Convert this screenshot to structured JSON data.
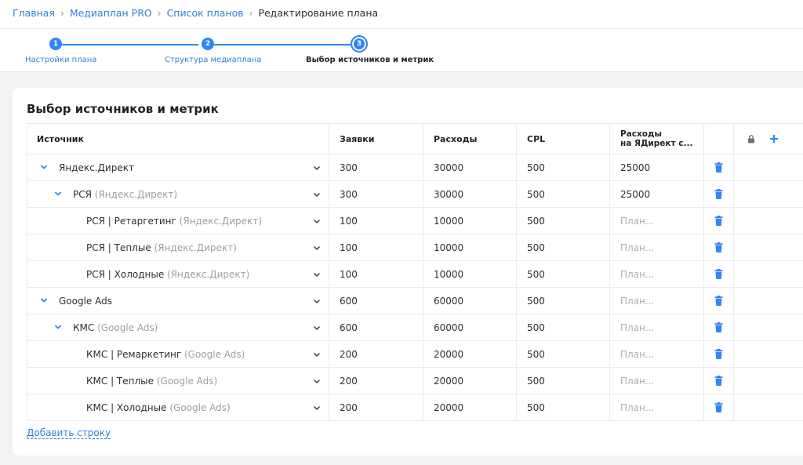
{
  "breadcrumb": {
    "items": [
      "Главная",
      "Медиаплан PRO",
      "Список планов"
    ],
    "current": "Редактирование плана"
  },
  "stepper": {
    "steps": [
      {
        "num": "1",
        "label": "Настройки плана",
        "state": "done"
      },
      {
        "num": "2",
        "label": "Структура медиаплана",
        "state": "done"
      },
      {
        "num": "3",
        "label": "Выбор источников и метрик",
        "state": "active"
      }
    ]
  },
  "card": {
    "title": "Выбор источников и метрик",
    "add_row": "Добавить строку"
  },
  "table": {
    "headers": {
      "source": "Источник",
      "leads": "Заявки",
      "cost": "Расходы",
      "cpl": "CPL",
      "yd_line1": "Расходы",
      "yd_line2": "на ЯДирект с..."
    },
    "placeholder": "План...",
    "rows": [
      {
        "name": "Яндекс.Директ",
        "sub": "",
        "leads": "300",
        "cost": "30000",
        "cpl": "500",
        "yd": "25000"
      },
      {
        "name": "РСЯ",
        "sub": "(Яндекс.Директ)",
        "leads": "300",
        "cost": "30000",
        "cpl": "500",
        "yd": "25000"
      },
      {
        "name": "РСЯ | Ретаргетинг",
        "sub": "(Яндекс.Директ)",
        "leads": "100",
        "cost": "10000",
        "cpl": "500",
        "yd": ""
      },
      {
        "name": "РСЯ | Теплые",
        "sub": "(Яндекс.Директ)",
        "leads": "100",
        "cost": "10000",
        "cpl": "500",
        "yd": ""
      },
      {
        "name": "РСЯ | Холодные",
        "sub": "(Яндекс.Директ)",
        "leads": "100",
        "cost": "10000",
        "cpl": "500",
        "yd": ""
      },
      {
        "name": "Google Ads",
        "sub": "",
        "leads": "600",
        "cost": "60000",
        "cpl": "500",
        "yd": ""
      },
      {
        "name": "КМС",
        "sub": "(Google Ads)",
        "leads": "600",
        "cost": "60000",
        "cpl": "500",
        "yd": ""
      },
      {
        "name": "КМС | Ремаркетинг",
        "sub": "(Google Ads)",
        "leads": "200",
        "cost": "20000",
        "cpl": "500",
        "yd": ""
      },
      {
        "name": "КМС | Теплые",
        "sub": "(Google Ads)",
        "leads": "200",
        "cost": "20000",
        "cpl": "500",
        "yd": ""
      },
      {
        "name": "КМС | Холодные",
        "sub": "(Google Ads)",
        "leads": "200",
        "cost": "20000",
        "cpl": "500",
        "yd": ""
      }
    ]
  },
  "colors": {
    "accent": "#2f86f6",
    "link": "#2f7fe0",
    "text": "#2b2f36",
    "muted": "#9aa0a8",
    "background": "#f1f2f4"
  },
  "icons": {
    "expand": "chevron-down-icon",
    "dropdown": "chevron-down-icon",
    "delete": "trash-icon",
    "lock": "lock-icon",
    "add": "plus-icon"
  }
}
